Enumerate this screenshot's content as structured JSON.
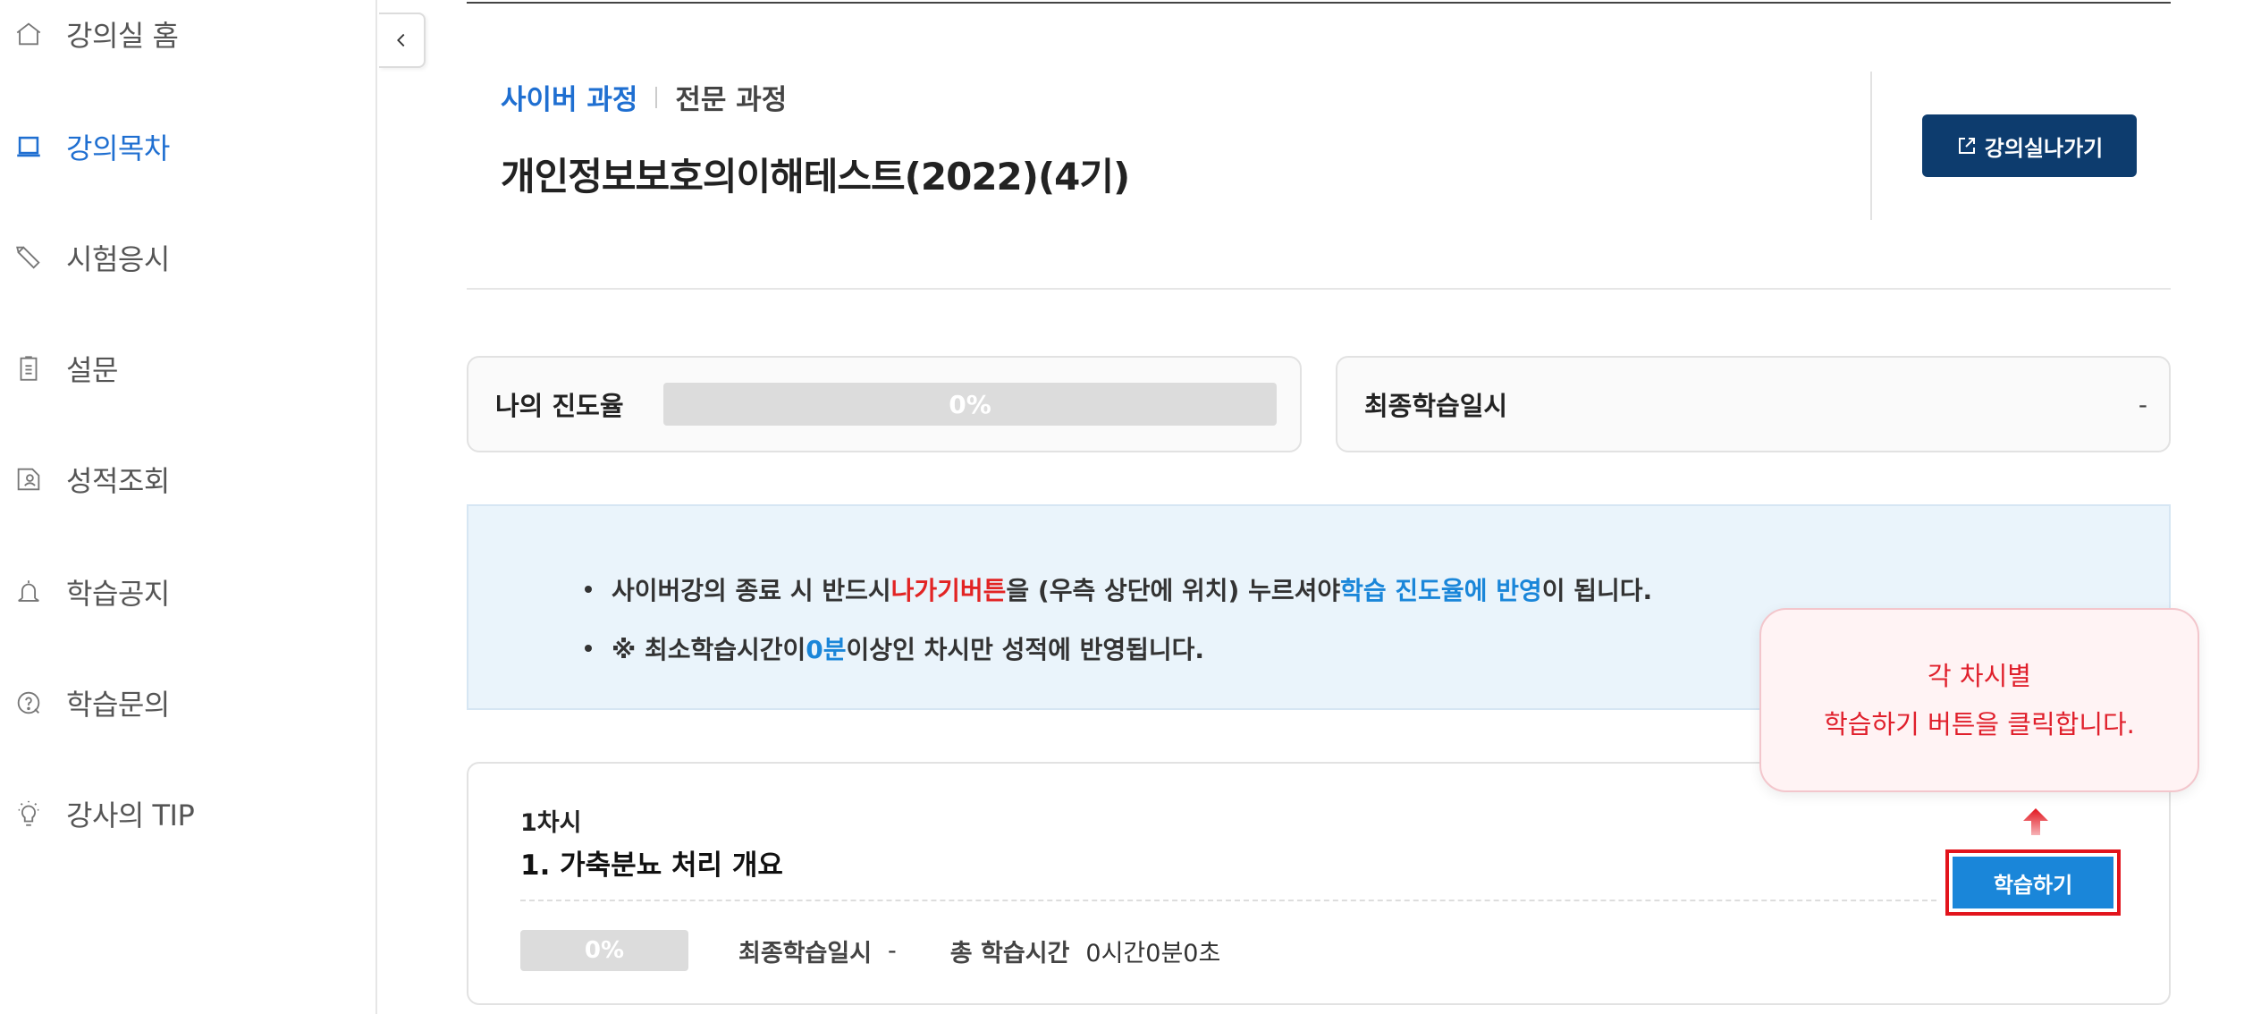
{
  "sidebar": {
    "items": [
      {
        "label": "강의실 홈",
        "icon": "home-icon",
        "active": false
      },
      {
        "label": "강의목차",
        "icon": "book-icon",
        "active": true
      },
      {
        "label": "시험응시",
        "icon": "pencil-icon",
        "active": false
      },
      {
        "label": "설문",
        "icon": "clipboard-icon",
        "active": false
      },
      {
        "label": "성적조회",
        "icon": "report-icon",
        "active": false
      },
      {
        "label": "학습공지",
        "icon": "bell-icon",
        "active": false
      },
      {
        "label": "학습문의",
        "icon": "question-icon",
        "active": false
      },
      {
        "label": "강사의 TIP",
        "icon": "lightbulb-icon",
        "active": false
      }
    ],
    "active_color": "#1f6fd1"
  },
  "header": {
    "breadcrumb": {
      "primary": "사이버 과정",
      "secondary": "전문 과정"
    },
    "title": "개인정보보호의이해테스트(2022)(4기)",
    "exit_label": "강의실나가기"
  },
  "progress": {
    "label": "나의 진도율",
    "value_text": "0%",
    "value": 0
  },
  "last_study": {
    "label": "최종학습일시",
    "value": "-"
  },
  "notice": {
    "line1": {
      "part1": "사이버강의 종료 시 반드시 ",
      "highlight_red": "나가기버튼",
      "part2": "을 (우측 상단에 위치) 누르셔야 ",
      "highlight_blue": "학습 진도율에 반영",
      "part3": "이 됩니다."
    },
    "line2": {
      "part1": "※ 최소학습시간이 ",
      "highlight_blue": "0분",
      "part2": " 이상인 차시만 성적에 반영됩니다."
    }
  },
  "lesson": {
    "session": "1차시",
    "title": "1. 가축분뇨 처리 개요",
    "progress_text": "0%",
    "progress": 0,
    "last_study_label": "최종학습일시",
    "last_study_value": "-",
    "total_time_label": "총 학습시간",
    "total_time_value": "0시간0분0초",
    "study_button": "학습하기"
  },
  "tooltip": {
    "line1": "각 차시별",
    "line2": "학습하기 버튼을 클릭합니다."
  },
  "colors": {
    "primary_blue": "#1f6fd1",
    "navy": "#0d3c6e",
    "highlight_red": "#e22424",
    "button_blue": "#1a86d9",
    "notice_bg": "#eaf4fb"
  }
}
